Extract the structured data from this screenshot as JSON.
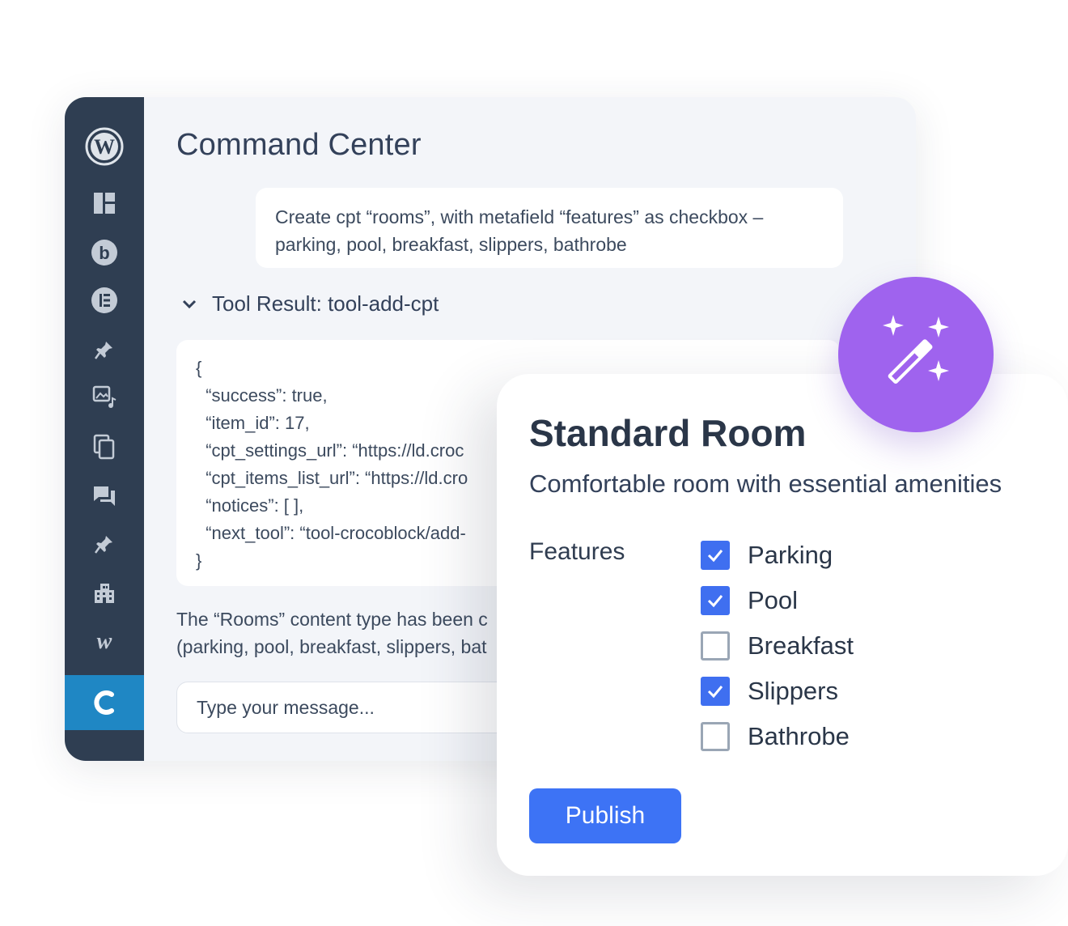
{
  "command_center": {
    "title": "Command Center",
    "prompt": "Create cpt “rooms”, with metafield “features” as checkbox – parking, pool, breakfast, slippers, bathrobe",
    "tool_result_label": "Tool Result: tool-add-cpt",
    "code_lines": [
      "{",
      "  “success”: true,",
      "  “item_id”: 17,",
      "  “cpt_settings_url”: “https://ld.croc",
      "  “cpt_items_list_url”: “https://ld.cro",
      "  “notices”: [ ],",
      "  “next_tool”: “tool-crocoblock/add-",
      "}"
    ],
    "reply_line1": "The “Rooms” content type has been c",
    "reply_line2": "(parking, pool, breakfast, slippers, bat",
    "message_placeholder": "Type your message..."
  },
  "sidebar": {
    "items": [
      {
        "icon": "wordpress-logo-icon"
      },
      {
        "icon": "dashboard-icon"
      },
      {
        "icon": "b-circle-icon"
      },
      {
        "icon": "elementor-icon"
      },
      {
        "icon": "pin-icon"
      },
      {
        "icon": "media-icon"
      },
      {
        "icon": "pages-icon"
      },
      {
        "icon": "comments-icon"
      },
      {
        "icon": "pin-icon"
      },
      {
        "icon": "building-icon"
      },
      {
        "icon": "woo-icon"
      },
      {
        "icon": "crocoblock-icon"
      }
    ],
    "active_color": "#1f87c4",
    "background": "#2f3e52"
  },
  "card": {
    "title": "Standard Room",
    "subtitle": "Comfortable room with essential amenities",
    "features_label": "Features",
    "features": [
      {
        "label": "Parking",
        "checked": true
      },
      {
        "label": "Pool",
        "checked": true
      },
      {
        "label": "Breakfast",
        "checked": false
      },
      {
        "label": "Slippers",
        "checked": true
      },
      {
        "label": "Bathrobe",
        "checked": false
      }
    ],
    "publish_label": "Publish",
    "accent": "#3d73f5"
  },
  "magic_badge": {
    "icon": "magic-wand-icon",
    "color": "#9f63ee"
  }
}
